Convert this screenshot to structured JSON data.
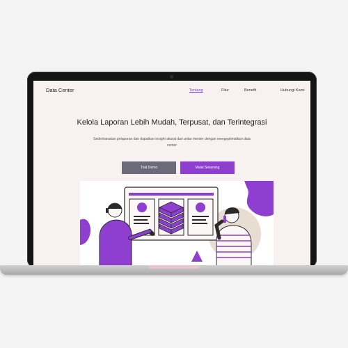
{
  "nav": {
    "brand": "Data Center",
    "links": [
      "Tentang",
      "Fitur",
      "Benefit",
      "Hubungi Kami"
    ],
    "active_index": 0
  },
  "hero": {
    "title": "Kelola Laporan Lebih Mudah, Terpusat, dan Terintegrasi",
    "subtitle": "Sederhanakan pelaporan dan dapatkan insight akurat dari antar menter dengan mengoptimalkan data center",
    "btn_demo": "Trial Demo",
    "btn_start": "Mulai Sekarang"
  },
  "colors": {
    "accent": "#8e3fd0",
    "secondary_button": "#6c6978",
    "page_background": "#f8f1f1"
  }
}
